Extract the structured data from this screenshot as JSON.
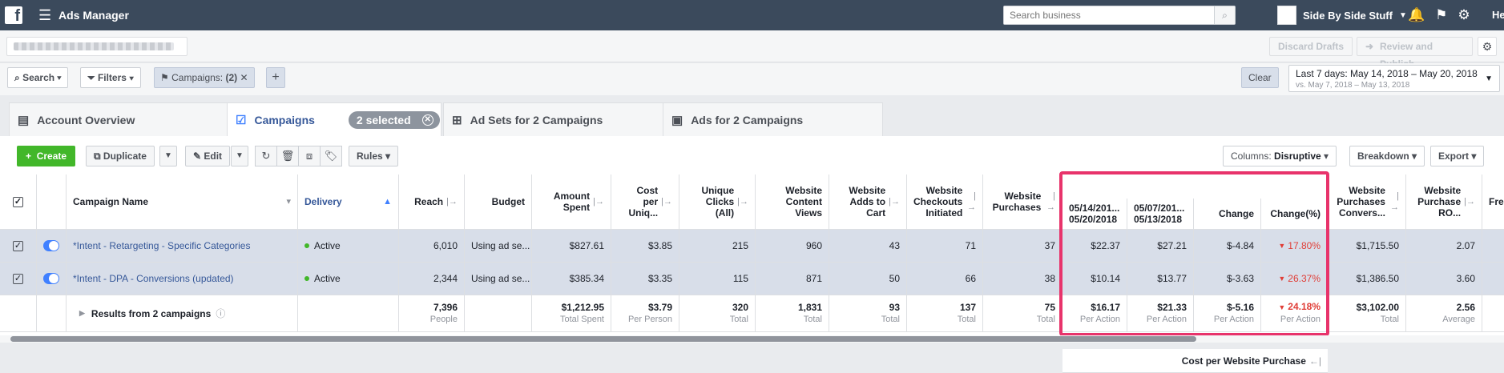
{
  "topbar": {
    "logo": "f",
    "title": "Ads Manager",
    "search_placeholder": "Search business",
    "account": "Side By Side Stuff",
    "user": "He"
  },
  "subbar": {
    "discard": "Discard Drafts",
    "review": "Review and Publish"
  },
  "filters": {
    "search": "Search",
    "filters": "Filters",
    "chip_label": "Campaigns:",
    "chip_count": "(2)",
    "clear": "Clear",
    "date_main": "Last 7 days: May 14, 2018 – May 20, 2018",
    "date_sub": "vs. May 7, 2018 – May 13, 2018"
  },
  "tabs": {
    "overview": "Account Overview",
    "campaigns": "Campaigns",
    "selected": "2 selected",
    "adsets": "Ad Sets for 2 Campaigns",
    "ads": "Ads for 2 Campaigns"
  },
  "toolbar": {
    "create": "Create",
    "duplicate": "Duplicate",
    "edit": "Edit",
    "rules": "Rules",
    "columns_label": "Columns:",
    "columns_value": "Disruptive",
    "breakdown": "Breakdown",
    "export": "Export"
  },
  "columns": {
    "campaign_name": "Campaign Name",
    "delivery": "Delivery",
    "reach": "Reach",
    "budget": "Budget",
    "amount_spent": "Amount Spent",
    "cost_per_unique": "Cost per Uniq...",
    "unique_clicks": "Unique Clicks (All)",
    "content_views": "Website Content Views",
    "adds_to_cart": "Website Adds to Cart",
    "checkouts": "Website Checkouts Initiated",
    "purchases": "Website Purchases",
    "cpp_group": "Cost per Website Purchase",
    "cpp_cur": "05/14/201... 05/20/2018",
    "cpp_prev": "05/07/201... 05/13/2018",
    "cpp_change": "Change",
    "cpp_change_pct": "Change(%)",
    "conv_value": "Website Purchases Convers...",
    "roas": "Website Purchase RO...",
    "freq": "Fre"
  },
  "rows": [
    {
      "name": "*Intent - Retargeting - Specific Categories",
      "delivery": "Active",
      "reach": "6,010",
      "budget": "Using ad se...",
      "spent": "$827.61",
      "cpu": "$3.85",
      "clicks": "215",
      "views": "960",
      "carts": "43",
      "checkouts": "71",
      "purchases": "37",
      "cpp_cur": "$22.37",
      "cpp_prev": "$27.21",
      "change": "$-4.84",
      "change_pct": "17.80%",
      "conv": "$1,715.50",
      "roas": "2.07"
    },
    {
      "name": "*Intent - DPA - Conversions (updated)",
      "delivery": "Active",
      "reach": "2,344",
      "budget": "Using ad se...",
      "spent": "$385.34",
      "cpu": "$3.35",
      "clicks": "115",
      "views": "871",
      "carts": "50",
      "checkouts": "66",
      "purchases": "38",
      "cpp_cur": "$10.14",
      "cpp_prev": "$13.77",
      "change": "$-3.63",
      "change_pct": "26.37%",
      "conv": "$1,386.50",
      "roas": "3.60"
    }
  ],
  "totals": {
    "label": "Results from 2 campaigns",
    "reach": "7,396",
    "reach_l": "People",
    "spent": "$1,212.95",
    "spent_l": "Total Spent",
    "cpu": "$3.79",
    "cpu_l": "Per Person",
    "clicks": "320",
    "clicks_l": "Total",
    "views": "1,831",
    "views_l": "Total",
    "carts": "93",
    "carts_l": "Total",
    "checkouts": "137",
    "checkouts_l": "Total",
    "purchases": "75",
    "purchases_l": "Total",
    "cpp_cur": "$16.17",
    "cpp_cur_l": "Per Action",
    "cpp_prev": "$21.33",
    "cpp_prev_l": "Per Action",
    "change": "$-5.16",
    "change_l": "Per Action",
    "change_pct": "24.18%",
    "change_pct_l": "Per Action",
    "conv": "$3,102.00",
    "conv_l": "Total",
    "roas": "2.56",
    "roas_l": "Average"
  }
}
